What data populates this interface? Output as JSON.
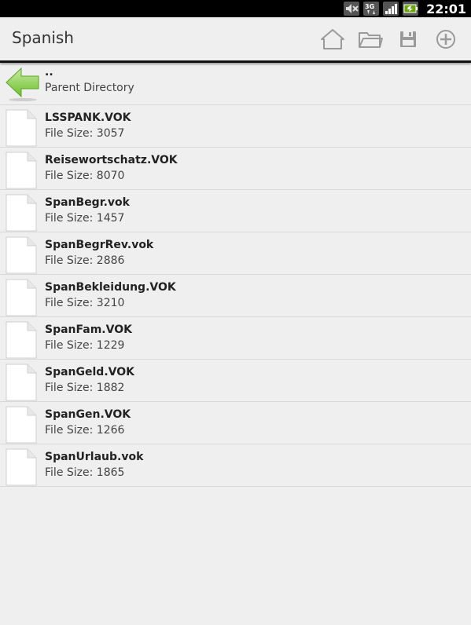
{
  "status_bar": {
    "time": "22:01",
    "icons": [
      "mute-icon",
      "3g-icon",
      "signal-icon",
      "battery-icon"
    ]
  },
  "action_bar": {
    "title": "Spanish",
    "actions": [
      "home-icon",
      "folder-icon",
      "save-icon",
      "add-icon"
    ]
  },
  "parent": {
    "name": "..",
    "label": "Parent Directory"
  },
  "files": [
    {
      "name": "LSSPANK.VOK",
      "size": "File Size: 3057"
    },
    {
      "name": "Reisewortschatz.VOK",
      "size": "File Size: 8070"
    },
    {
      "name": "SpanBegr.vok",
      "size": "File Size: 1457"
    },
    {
      "name": "SpanBegrRev.vok",
      "size": "File Size: 2886"
    },
    {
      "name": "SpanBekleidung.VOK",
      "size": "File Size: 3210"
    },
    {
      "name": "SpanFam.VOK",
      "size": "File Size: 1229"
    },
    {
      "name": "SpanGeld.VOK",
      "size": "File Size: 1882"
    },
    {
      "name": "SpanGen.VOK",
      "size": "File Size: 1266"
    },
    {
      "name": "SpanUrlaub.vok",
      "size": "File Size: 1865"
    }
  ]
}
